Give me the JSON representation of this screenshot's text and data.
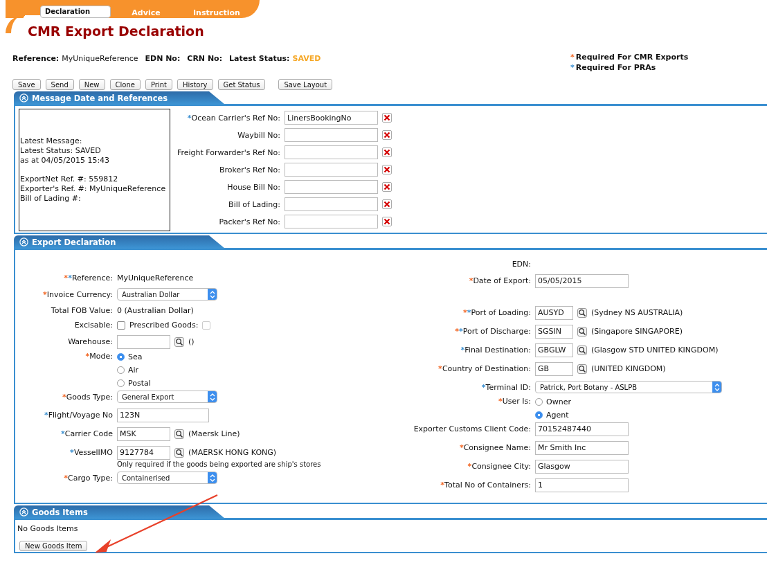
{
  "top_tabs": [
    {
      "label": "Declaration",
      "selected": true
    },
    {
      "label": "Advice",
      "selected": false
    },
    {
      "label": "Instruction",
      "selected": false
    }
  ],
  "page_title": "CMR Export Declaration",
  "summary": [
    {
      "label": "Reference:",
      "value": "MyUniqueReference"
    },
    {
      "label": "EDN No:"
    },
    {
      "label": "CRN No:"
    },
    {
      "label": "Latest Status:",
      "value": "SAVED",
      "kind": "status"
    }
  ],
  "legend": [
    {
      "mark": "*",
      "kind": "cmr",
      "text": "Required For CMR Exports"
    },
    {
      "mark": "*",
      "kind": "pra",
      "text": "Required For PRAs"
    }
  ],
  "toolbar": [
    {
      "label": "Save",
      "kind": "normal"
    },
    {
      "label": "Send",
      "kind": "normal"
    },
    {
      "label": "New",
      "kind": "normal"
    },
    {
      "label": "Clone",
      "kind": "normal"
    },
    {
      "label": "Print",
      "kind": "normal"
    },
    {
      "label": "History",
      "kind": "normal"
    },
    {
      "label": "Get Status",
      "kind": "normal"
    },
    {
      "label": "Save Layout",
      "kind": "separated"
    }
  ],
  "message_section": {
    "title": "Message Date and References",
    "info_box": [
      [
        "Latest Message:",
        "Latest Status: SAVED",
        "as at 04/05/2015 15:43"
      ],
      [
        "ExportNet Ref. #: 559812",
        "Exporter's Ref. #: MyUniqueReference",
        "Bill of Lading #:"
      ]
    ],
    "fields": [
      {
        "marks": [
          {
            "text": "*",
            "kind": "pra"
          }
        ],
        "label": "Ocean Carrier's Ref No:",
        "value": "LinersBookingNo"
      },
      {
        "label": "Waybill No:"
      },
      {
        "label": "Freight Forwarder's Ref No:"
      },
      {
        "label": "Broker's Ref No:"
      },
      {
        "label": "House Bill No:"
      },
      {
        "label": "Bill of Lading:"
      },
      {
        "label": "Packer's Ref No:"
      }
    ]
  },
  "export_section": {
    "title": "Export Declaration",
    "left": [
      {
        "kind": "text",
        "marks": [
          {
            "text": "*",
            "kind": "cmr"
          },
          {
            "text": "*",
            "kind": "pra"
          }
        ],
        "label": "Reference:",
        "value": "MyUniqueReference"
      },
      {
        "kind": "select",
        "marks": [
          {
            "text": "*",
            "kind": "cmr"
          }
        ],
        "label": "Invoice Currency:",
        "value": "Australian Dollar"
      },
      {
        "kind": "text",
        "label": "Total FOB Value:",
        "value": "0 (Australian Dollar)"
      },
      {
        "kind": "checks",
        "label": "Excisable:",
        "items": [
          {
            "checked": false,
            "disabled": false
          },
          {
            "label": "Prescribed Goods:",
            "checked": false,
            "disabled": true
          }
        ]
      },
      {
        "kind": "lookup",
        "label": "Warehouse:",
        "description": "()"
      },
      {
        "kind": "radio",
        "marks": [
          {
            "text": "*",
            "kind": "cmr"
          }
        ],
        "label": "Mode:",
        "options": [
          {
            "label": "Sea",
            "selected": true
          },
          {
            "label": "Air",
            "selected": false
          },
          {
            "label": "Postal",
            "selected": false
          }
        ]
      },
      {
        "kind": "select",
        "marks": [
          {
            "text": "*",
            "kind": "cmr"
          }
        ],
        "label": "Goods Type:",
        "value": "General Export"
      },
      {
        "kind": "input",
        "marks": [
          {
            "text": "*",
            "kind": "pra"
          }
        ],
        "label": "Flight/Voyage No",
        "value": "123N"
      },
      {
        "kind": "lookup",
        "marks": [
          {
            "text": "*",
            "kind": "pra"
          }
        ],
        "label": "Carrier Code",
        "value": "MSK",
        "description": "(Maersk Line)"
      },
      {
        "kind": "lookup",
        "marks": [
          {
            "text": "*",
            "kind": "pra"
          }
        ],
        "label": "VesselIMO",
        "value": "9127784",
        "description": "(MAERSK HONG KONG)"
      },
      {
        "kind": "note",
        "text": "Only required if the goods being exported are ship's stores"
      },
      {
        "kind": "select",
        "marks": [
          {
            "text": "*",
            "kind": "cmr"
          }
        ],
        "label": "Cargo Type:",
        "value": "Containerised"
      }
    ],
    "right": [
      {
        "kind": "text",
        "label": "EDN:"
      },
      {
        "kind": "input",
        "marks": [
          {
            "text": "*",
            "kind": "cmr"
          }
        ],
        "label": "Date of Export:",
        "value": "05/05/2015"
      },
      {
        "kind": "spacer"
      },
      {
        "kind": "lookup",
        "marks": [
          {
            "text": "*",
            "kind": "cmr"
          },
          {
            "text": "*",
            "kind": "pra"
          }
        ],
        "label": "Port of Loading:",
        "value": "AUSYD",
        "description": "(Sydney NS AUSTRALIA)"
      },
      {
        "kind": "lookup",
        "marks": [
          {
            "text": "*",
            "kind": "cmr"
          },
          {
            "text": "*",
            "kind": "pra"
          }
        ],
        "label": "Port of Discharge:",
        "value": "SGSIN",
        "description": "(Singapore SINGAPORE)"
      },
      {
        "kind": "lookup",
        "marks": [
          {
            "text": "*",
            "kind": "pra"
          }
        ],
        "label": "Final Destination:",
        "value": "GBGLW",
        "description": "(Glasgow STD UNITED KINGDOM)"
      },
      {
        "kind": "lookup",
        "marks": [
          {
            "text": "*",
            "kind": "cmr"
          }
        ],
        "label": "Country of Destination:",
        "value": "GB",
        "description": "(UNITED KINGDOM)"
      },
      {
        "kind": "select",
        "marks": [
          {
            "text": "*",
            "kind": "pra"
          }
        ],
        "label": "Terminal ID:",
        "value": "Patrick, Port Botany - ASLPB"
      },
      {
        "kind": "radio",
        "marks": [
          {
            "text": "*",
            "kind": "cmr"
          }
        ],
        "label": "User Is:",
        "options": [
          {
            "label": "Owner",
            "selected": false
          },
          {
            "label": "Agent",
            "selected": true
          }
        ]
      },
      {
        "kind": "input",
        "label": "Exporter Customs Client Code:",
        "value": "70152487440"
      },
      {
        "kind": "input",
        "marks": [
          {
            "text": "*",
            "kind": "cmr"
          }
        ],
        "label": "Consignee Name:",
        "value": "Mr Smith Inc"
      },
      {
        "kind": "input",
        "marks": [
          {
            "text": "*",
            "kind": "cmr"
          }
        ],
        "label": "Consignee City:",
        "value": "Glasgow"
      },
      {
        "kind": "input",
        "marks": [
          {
            "text": "*",
            "kind": "cmr"
          }
        ],
        "label": "Total No of Containers:",
        "value": "1"
      }
    ]
  },
  "goods_section": {
    "title": "Goods Items",
    "empty_text": "No Goods Items",
    "button": "New Goods Item"
  }
}
